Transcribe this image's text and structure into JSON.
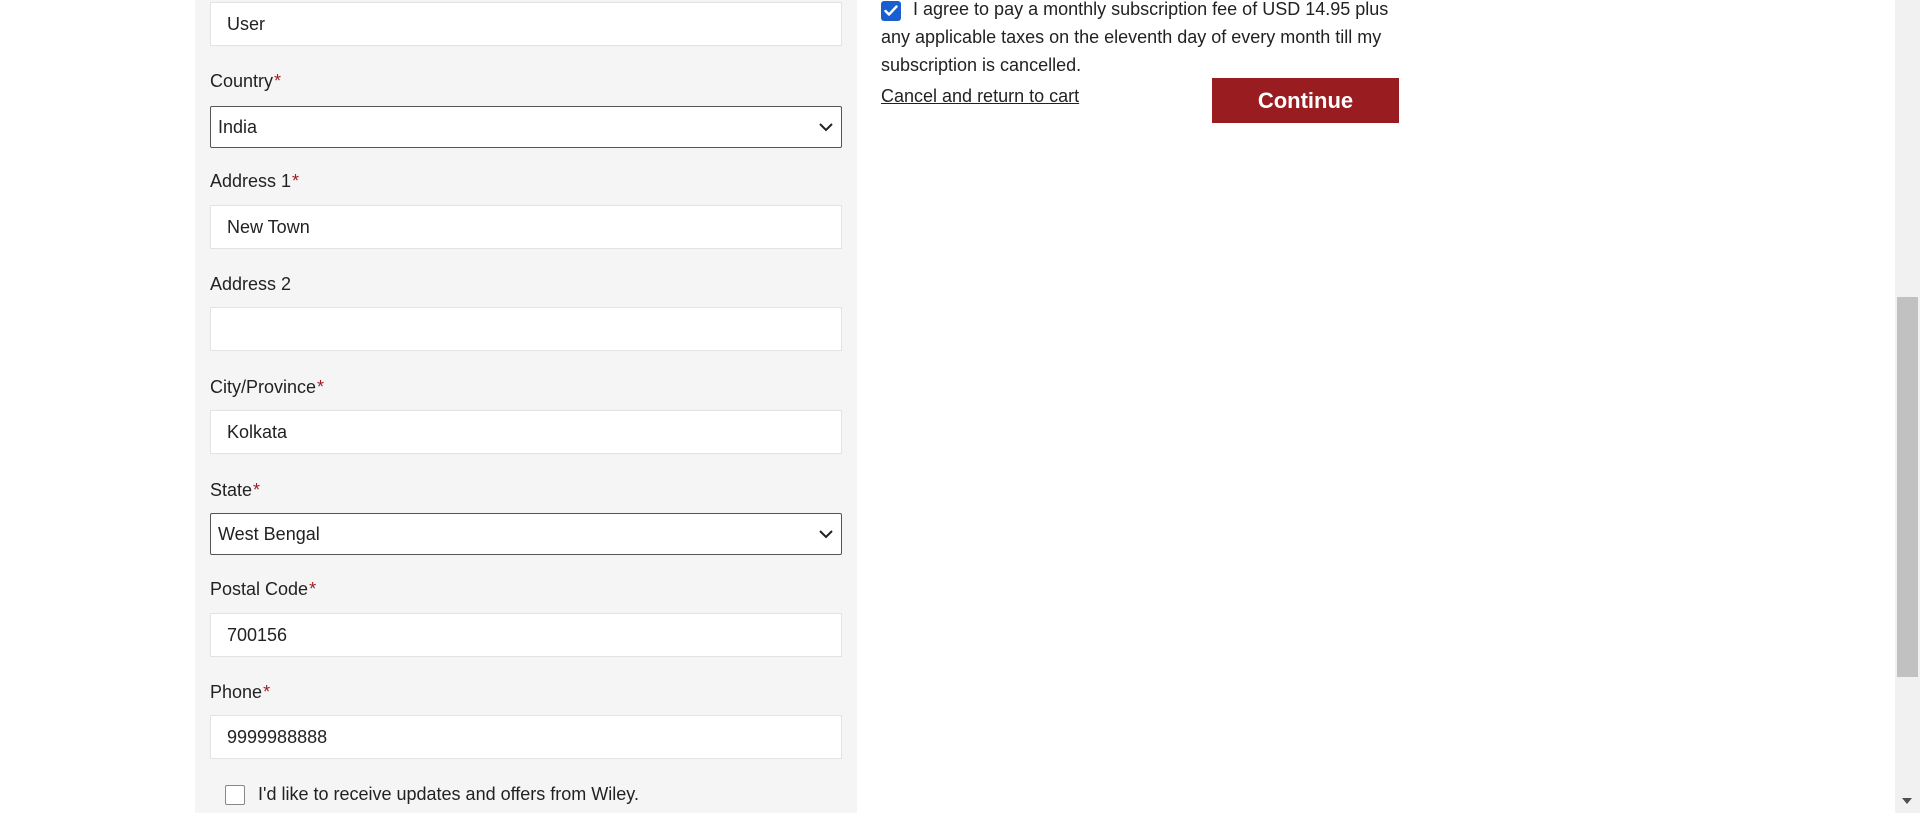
{
  "form": {
    "top_field_value": "User",
    "country": {
      "label": "Country",
      "value": "India"
    },
    "address1": {
      "label": "Address 1",
      "value": "New Town"
    },
    "address2": {
      "label": "Address 2",
      "value": ""
    },
    "city": {
      "label": "City/Province",
      "value": "Kolkata"
    },
    "state": {
      "label": "State",
      "value": "West Bengal"
    },
    "postal": {
      "label": "Postal Code",
      "value": "700156"
    },
    "phone": {
      "label": "Phone",
      "value": "9999988888"
    },
    "required_marker": "*",
    "updates_opt_in": {
      "label": "I'd like to receive updates and offers from Wiley.",
      "checked": false
    }
  },
  "agreement": {
    "checked": true,
    "text": "I agree to pay a monthly subscription fee of USD 14.95 plus any applicable taxes on the eleventh day of every month till my subscription is cancelled."
  },
  "actions": {
    "cancel_label": "Cancel and return to cart",
    "continue_label": "Continue"
  },
  "icons": {
    "select_chevron": "chevron-down-icon",
    "checkmark": "checkmark-icon",
    "scroll_down": "arrow-down-icon"
  },
  "colors": {
    "brand_red": "#991c20",
    "required_red": "#9b1c1f",
    "checkbox_blue": "#1a5fd0",
    "panel_bg": "#f5f5f5"
  }
}
